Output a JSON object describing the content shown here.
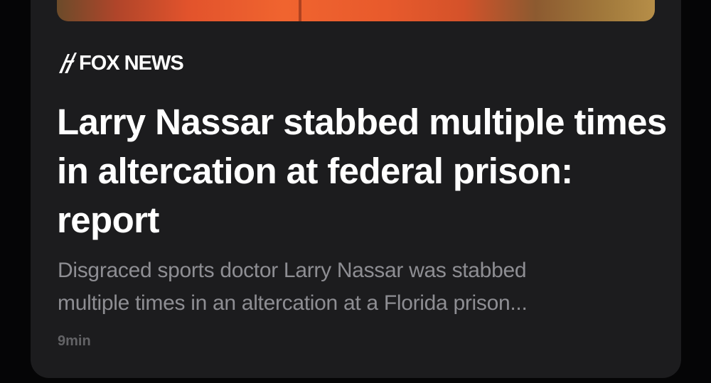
{
  "story": {
    "source": "FOX NEWS",
    "headline": "Larry Nassar stabbed multiple times in altercation at federal prison: report",
    "summary": "Disgraced sports doctor Larry Nassar was stabbed\nmultiple times in an altercation at a Florida prison...",
    "time": "9min",
    "thumbnail_icon": "photo-thumbnail",
    "source_icon": "fox-news-logo-icon"
  },
  "colors": {
    "background": "#050506",
    "card": "#1c1c1e",
    "headline": "#ffffff",
    "summary": "#8e8e93",
    "timestamp": "#636366"
  }
}
